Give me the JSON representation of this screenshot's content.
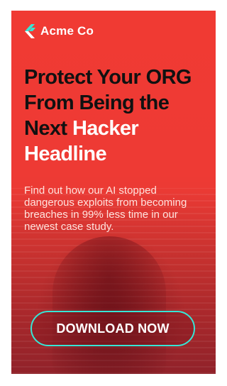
{
  "brand": {
    "name": "Acme Co",
    "logo_icon": "chevron-logo-icon",
    "logo_colors": [
      "#36e6d6",
      "#ffffff"
    ]
  },
  "headline": {
    "dark_text": "Protect Your ORG From Being the Next",
    "light_text": "Hacker Headline"
  },
  "body": "Find out how our AI stopped dangerous exploits from becoming breaches in 99% less time in our newest case study.",
  "cta": {
    "label": "DOWNLOAD NOW",
    "border_color": "#36e6d6"
  },
  "colors": {
    "background": "#ee3a34",
    "headline_dark": "#111111",
    "headline_light": "#ffffff"
  }
}
